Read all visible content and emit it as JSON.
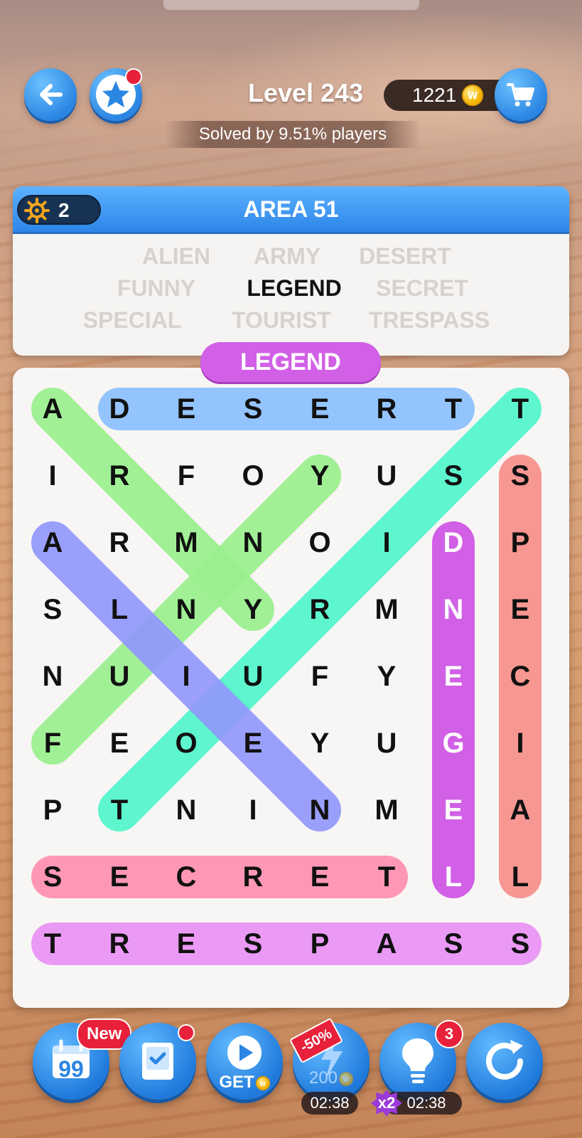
{
  "header": {
    "level_title": "Level 243",
    "solved_text": "Solved by 9.51% players",
    "coins": "1221",
    "coin_symbol": "W"
  },
  "card": {
    "title": "AREA 51",
    "gear_count": "2",
    "words": [
      {
        "text": "ALIEN",
        "found": true
      },
      {
        "text": "ARMY",
        "found": true
      },
      {
        "text": "DESERT",
        "found": true
      },
      {
        "text": "FUNNY",
        "found": true
      },
      {
        "text": "LEGEND",
        "found": false
      },
      {
        "text": "SECRET",
        "found": true
      },
      {
        "text": "SPECIAL",
        "found": true
      },
      {
        "text": "TOURIST",
        "found": true
      },
      {
        "text": "TRESPASS",
        "found": true
      }
    ]
  },
  "current_word": "LEGEND",
  "grid": [
    [
      "A",
      "D",
      "E",
      "S",
      "E",
      "R",
      "T",
      "T"
    ],
    [
      "I",
      "R",
      "F",
      "O",
      "Y",
      "U",
      "S",
      "S"
    ],
    [
      "A",
      "R",
      "M",
      "N",
      "O",
      "I",
      "D",
      "P"
    ],
    [
      "S",
      "L",
      "N",
      "Y",
      "R",
      "M",
      "N",
      "E"
    ],
    [
      "N",
      "U",
      "I",
      "U",
      "F",
      "Y",
      "E",
      "C"
    ],
    [
      "F",
      "E",
      "O",
      "E",
      "Y",
      "U",
      "G",
      "I"
    ],
    [
      "P",
      "T",
      "N",
      "I",
      "N",
      "M",
      "E",
      "A"
    ],
    [
      "S",
      "E",
      "C",
      "R",
      "E",
      "T",
      "L",
      "L"
    ],
    [
      "T",
      "R",
      "E",
      "S",
      "P",
      "A",
      "S",
      "S"
    ]
  ],
  "highlight_colors": {
    "DESERT": "#8cc0ff",
    "ARMY": "#9af08f",
    "FUNNY": "#9af08f",
    "TOURIST": "#52f7cc",
    "ALIEN": "#9198fb",
    "LEGEND": "#d160e6",
    "SPECIAL": "#f78f8a",
    "SECRET": "#ff8fb0",
    "TRESPASS": "#e993f6"
  },
  "toolbar": {
    "new_badge": "New",
    "get_label": "GET",
    "boost_price": "200",
    "sale_label": "-50%",
    "hint_count": "3",
    "boost_timer": "02:38",
    "hint_timer": "02:38",
    "multiplier": "x2"
  },
  "icons": {
    "back": "back-arrow-icon",
    "star": "star-icon",
    "cart": "cart-icon",
    "gear": "gear-icon",
    "calendar": "calendar-quote-icon",
    "book": "book-check-icon",
    "play": "play-icon",
    "lightning": "lightning-icon",
    "hint": "lightbulb-icon",
    "refresh": "refresh-icon"
  }
}
